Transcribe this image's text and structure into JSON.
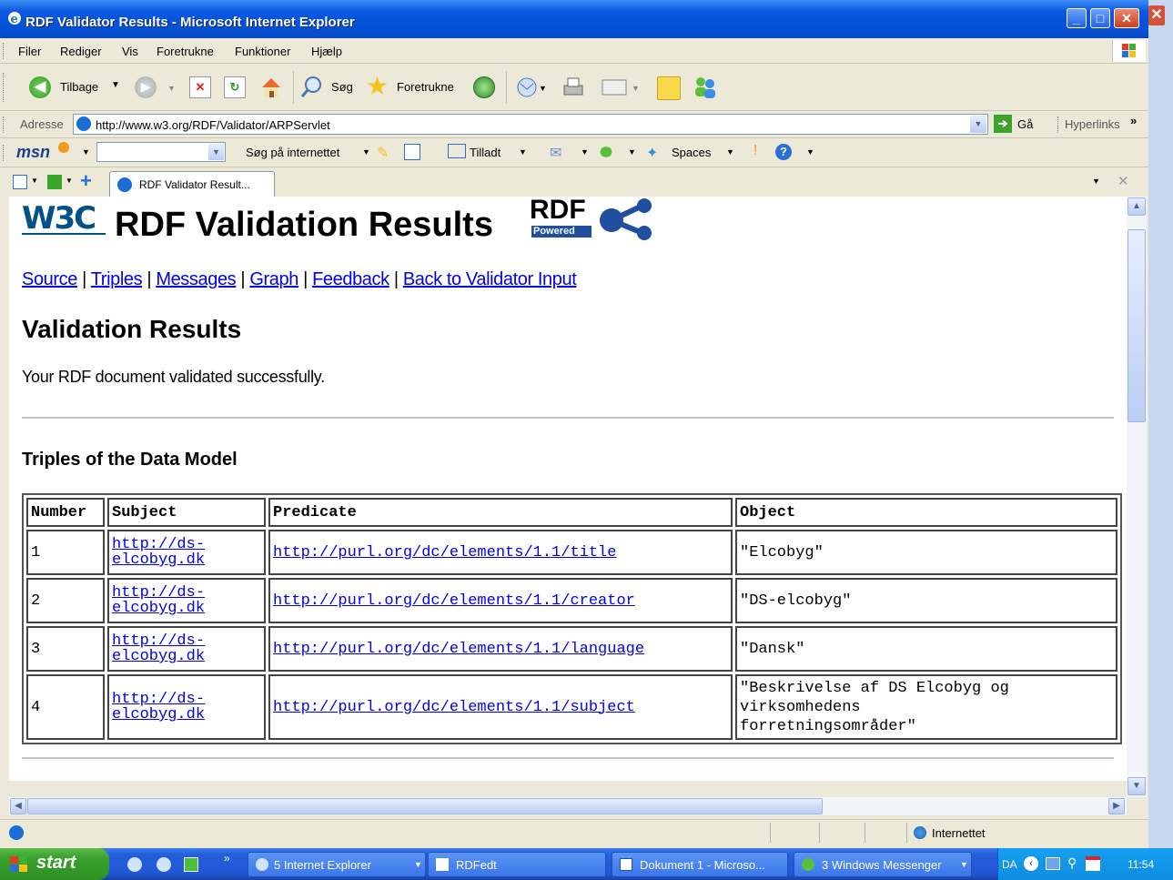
{
  "window": {
    "title": "RDF Validator Results - Microsoft Internet Explorer"
  },
  "menu": [
    "Filer",
    "Rediger",
    "Vis",
    "Foretrukne",
    "Funktioner",
    "Hjælp"
  ],
  "toolbar": {
    "back_label": "Tilbage",
    "search_label": "Søg",
    "favorites_label": "Foretrukne"
  },
  "address": {
    "label": "Adresse",
    "url": "http://www.w3.org/RDF/Validator/ARPServlet",
    "go_label": "Gå",
    "links_label": "Hyperlinks"
  },
  "msnbar": {
    "logo": "msn",
    "search_label": "Søg på internettet",
    "allowed_label": "Tilladt",
    "spaces_label": "Spaces"
  },
  "tab": {
    "label": "RDF Validator Result..."
  },
  "page": {
    "logo_text": "W3C",
    "heading": "RDF Validation Results",
    "rdf_logo_top": "RDF",
    "rdf_logo_bottom": "Powered",
    "nav_links": [
      "Source",
      "Triples",
      "Messages",
      "Graph",
      "Feedback",
      "Back to Validator Input"
    ],
    "section_title": "Validation Results",
    "message": "Your RDF document validated successfully.",
    "triples_title": "Triples of the Data Model",
    "table": {
      "headers": [
        "Number",
        "Subject",
        "Predicate",
        "Object"
      ],
      "rows": [
        {
          "number": "1",
          "subject_line1": "http://ds-",
          "subject_line2": "elcobyg.dk",
          "predicate": "http://purl.org/dc/elements/1.1/title",
          "object_lines": [
            "\"Elcobyg\""
          ]
        },
        {
          "number": "2",
          "subject_line1": "http://ds-",
          "subject_line2": "elcobyg.dk",
          "predicate": "http://purl.org/dc/elements/1.1/creator",
          "object_lines": [
            "\"DS-elcobyg\""
          ]
        },
        {
          "number": "3",
          "subject_line1": "http://ds-",
          "subject_line2": "elcobyg.dk",
          "predicate": "http://purl.org/dc/elements/1.1/language",
          "object_lines": [
            "\"Dansk\""
          ]
        },
        {
          "number": "4",
          "subject_line1": "http://ds-",
          "subject_line2": "elcobyg.dk",
          "predicate": "http://purl.org/dc/elements/1.1/subject",
          "object_lines": [
            "\"Beskrivelse af DS Elcobyg og",
            "virksomhedens",
            "forretningsområder\""
          ]
        }
      ]
    }
  },
  "status": {
    "zone": "Internettet"
  },
  "taskbar": {
    "start_label": "start",
    "tasks": [
      "5 Internet Explorer",
      "RDFedt",
      "Dokument 1 - Microso...",
      "3 Windows Messenger"
    ],
    "lang": "DA",
    "clock": "11:54"
  }
}
